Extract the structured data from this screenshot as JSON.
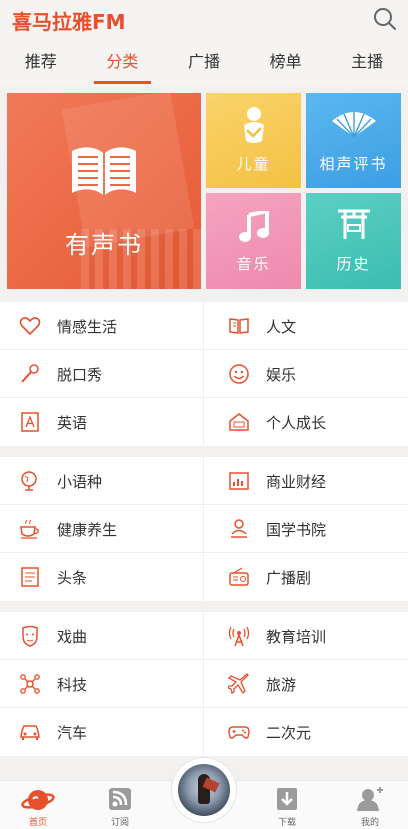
{
  "app": {
    "logo": "喜马拉雅FM"
  },
  "tabs": [
    {
      "label": "推荐",
      "active": false
    },
    {
      "label": "分类",
      "active": true
    },
    {
      "label": "广播",
      "active": false
    },
    {
      "label": "榜单",
      "active": false
    },
    {
      "label": "主播",
      "active": false
    }
  ],
  "hero": {
    "audiobook": "有声书",
    "kids": "儿童",
    "crosstalk": "相声评书",
    "music": "音乐",
    "history": "历史"
  },
  "sections": [
    [
      {
        "left": {
          "label": "情感生活",
          "icon": "heart-icon"
        },
        "right": {
          "label": "人文",
          "icon": "book-open-icon"
        }
      },
      {
        "left": {
          "label": "脱口秀",
          "icon": "microphone-icon"
        },
        "right": {
          "label": "娱乐",
          "icon": "smiley-icon"
        }
      },
      {
        "left": {
          "label": "英语",
          "icon": "letter-a-icon"
        },
        "right": {
          "label": "个人成长",
          "icon": "house-icon"
        }
      }
    ],
    [
      {
        "left": {
          "label": "小语种",
          "icon": "globe-icon"
        },
        "right": {
          "label": "商业财经",
          "icon": "bar-chart-icon"
        }
      },
      {
        "left": {
          "label": "健康养生",
          "icon": "teacup-icon"
        },
        "right": {
          "label": "国学书院",
          "icon": "scholar-icon"
        }
      },
      {
        "left": {
          "label": "头条",
          "icon": "newspaper-icon"
        },
        "right": {
          "label": "广播剧",
          "icon": "radio-icon"
        }
      }
    ],
    [
      {
        "left": {
          "label": "戏曲",
          "icon": "opera-mask-icon"
        },
        "right": {
          "label": "教育培训",
          "icon": "broadcast-tower-icon"
        }
      },
      {
        "left": {
          "label": "科技",
          "icon": "molecule-icon"
        },
        "right": {
          "label": "旅游",
          "icon": "airplane-icon"
        }
      },
      {
        "left": {
          "label": "汽车",
          "icon": "car-icon"
        },
        "right": {
          "label": "二次元",
          "icon": "gamepad-icon"
        }
      }
    ]
  ],
  "nav": {
    "home": "首页",
    "subscribe": "订阅",
    "download": "下载",
    "mine": "我的"
  },
  "colors": {
    "accent": "#e8502d"
  }
}
